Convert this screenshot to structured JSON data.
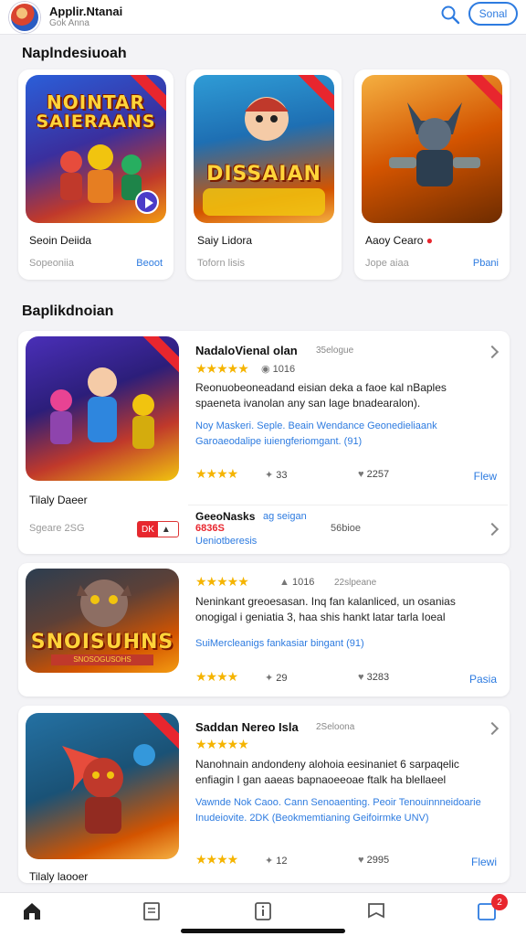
{
  "header": {
    "title": "Applir.Ntanai",
    "subtitle": "Gok Anna",
    "button_label": "Sonal"
  },
  "featured": {
    "section_title": "Naplndesiuoah",
    "cards": [
      {
        "art_title_1": "NOINTAR",
        "art_title_2": "SAIERAANS",
        "name": "Seoin Deiida",
        "meta": "Sopeoniia",
        "link": "Beoot"
      },
      {
        "art_title_1": "DISSAIAN",
        "art_title_2": "",
        "name": "Saiy Lidora",
        "meta": "Toforn lisis",
        "link": ""
      },
      {
        "art_title_1": "",
        "art_title_2": "",
        "name": "Aaoy Cearo",
        "meta": "Jope aiaa",
        "link": "Pbani"
      }
    ]
  },
  "list": {
    "section_title": "Baplikdnoian",
    "items": [
      {
        "title": "NadaloVienal olan",
        "category": "35elogue",
        "rating_count": "1016",
        "desc": "Reonuobeoneadand eisian deka a faoe kal nBaples spaeneta ivanolan any san lage bnadearalon).",
        "tags": "Noy Maskeri. Seple. Beain Wendance Geonedieliaank Garoaeodalipe iuiengferiomgant. (91)",
        "stat1": "33",
        "stat2": "2257",
        "link": "Flew",
        "foot_name": "Tilaly Daeer",
        "foot_meta": "Sgeare 2SG",
        "foot_pill": "DK",
        "sub_title": "GeeoNasks",
        "sub_cat": "ag seigan",
        "sub_red": "6836S",
        "sub_blue": "Ueniotberesis",
        "sub_num": "56bioe"
      },
      {
        "title": "",
        "category": "22slpeane",
        "rating_count": "1016",
        "desc": "Neninkant greoesasan. Inq fan kalanliced, un osanias onogigal i geniatia 3, haa shis hankt latar tarla Ioeal",
        "tags": "SuiMercleanigs fankasiar bingant (91)",
        "stat1": "29",
        "stat2": "3283",
        "link": "Pasia",
        "art_title_1": "SNOISUHNS",
        "banner": "SNOSOGUSOHS"
      },
      {
        "title": "Saddan Nereo Isla",
        "category": "2Seloona",
        "rating_count": "",
        "desc": "Nanohnain andondeny alohoia eesinaniet 6 sarpaqelic enfiagin I gan aaeas bapnaoeeoae ftalk ha blellaeel",
        "tags": "Vawnde Nok Caoo. Cann Senoaenting. Peoir Tenouinnneidoarie Inudeiovite. 2DK (Beokmemtianing Geifoirmke UNV)",
        "stat1": "12",
        "stat2": "2995",
        "link": "Flewi",
        "foot_name": "Tilaly laooer"
      }
    ]
  },
  "tabbar": {
    "badge": "2"
  }
}
